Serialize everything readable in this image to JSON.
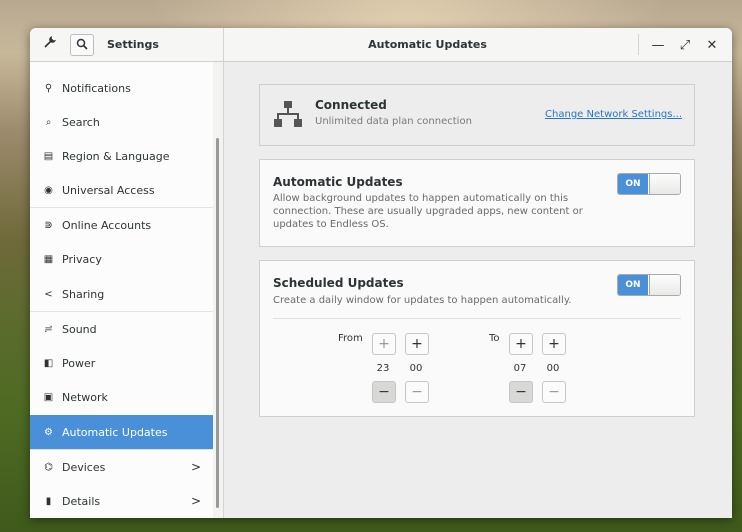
{
  "header": {
    "left_title": "Settings",
    "title": "Automatic Updates",
    "controls": {
      "minimize": "—",
      "maximize": "⤢",
      "close": "✕"
    }
  },
  "sidebar": {
    "items": [
      {
        "label": "Notifications",
        "icon": "⚲",
        "selected": false
      },
      {
        "label": "Search",
        "icon": "⌕",
        "selected": false
      },
      {
        "label": "Region & Language",
        "icon": "▤",
        "selected": false
      },
      {
        "label": "Universal Access",
        "icon": "◉",
        "selected": false
      },
      {
        "label": "Online Accounts",
        "icon": "⋑",
        "selected": false
      },
      {
        "label": "Privacy",
        "icon": "▦",
        "selected": false
      },
      {
        "label": "Sharing",
        "icon": "<",
        "selected": false
      },
      {
        "label": "Sound",
        "icon": "≓",
        "selected": false
      },
      {
        "label": "Power",
        "icon": "◧",
        "selected": false
      },
      {
        "label": "Network",
        "icon": "▣",
        "selected": false
      },
      {
        "label": "Automatic Updates",
        "icon": "⚙",
        "selected": true
      },
      {
        "label": "Devices",
        "icon": "⌬",
        "selected": false,
        "chevron": ">"
      },
      {
        "label": "Details",
        "icon": "▮",
        "selected": false,
        "chevron": ">"
      }
    ]
  },
  "network": {
    "title": "Connected",
    "subtitle": "Unlimited data plan connection",
    "link": "Change Network Settings..."
  },
  "auto_updates": {
    "title": "Automatic Updates",
    "description": "Allow background updates to happen automatically on this connection. These are usually upgraded apps, new content or updates to Endless OS.",
    "toggle": "ON"
  },
  "scheduled": {
    "title": "Scheduled Updates",
    "description": "Create a daily window for updates to happen automatically.",
    "toggle": "ON",
    "from_label": "From",
    "to_label": "To",
    "from_hour": "23",
    "from_minute": "00",
    "to_hour": "07",
    "to_minute": "00",
    "plus": "+",
    "minus": "−"
  },
  "colors": {
    "accent": "#4a90d9",
    "link": "#2a76c6"
  }
}
